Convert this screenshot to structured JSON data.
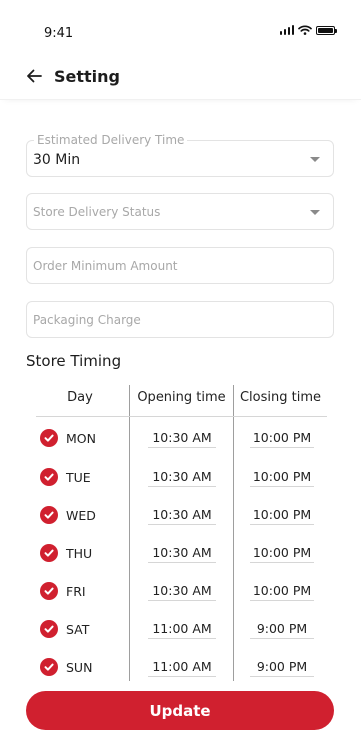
{
  "status_bar": {
    "time": "9:41"
  },
  "header": {
    "title": "Setting"
  },
  "form": {
    "estimated_delivery": {
      "label": "Estimated Delivery Time",
      "value": "30 Min"
    },
    "store_delivery_status": {
      "placeholder": "Store Delivery Status"
    },
    "order_minimum": {
      "placeholder": "Order Minimum Amount"
    },
    "packaging_charge": {
      "placeholder": "Packaging Charge"
    }
  },
  "store_timing": {
    "title": "Store Timing",
    "headers": {
      "day": "Day",
      "opening": "Opening time",
      "closing": "Closing time"
    },
    "rows": [
      {
        "day": "MON",
        "opening": "10:30 AM",
        "closing": "10:00 PM",
        "checked": true
      },
      {
        "day": "TUE",
        "opening": "10:30 AM",
        "closing": "10:00 PM",
        "checked": true
      },
      {
        "day": "WED",
        "opening": "10:30 AM",
        "closing": "10:00 PM",
        "checked": true
      },
      {
        "day": "THU",
        "opening": "10:30 AM",
        "closing": "10:00 PM",
        "checked": true
      },
      {
        "day": "FRI",
        "opening": "10:30 AM",
        "closing": "10:00 PM",
        "checked": true
      },
      {
        "day": "SAT",
        "opening": "11:00 AM",
        "closing": "9:00 PM",
        "checked": true
      },
      {
        "day": "SUN",
        "opening": "11:00 AM",
        "closing": "9:00 PM",
        "checked": true
      }
    ]
  },
  "actions": {
    "update_label": "Update"
  },
  "colors": {
    "accent": "#d0202f"
  }
}
